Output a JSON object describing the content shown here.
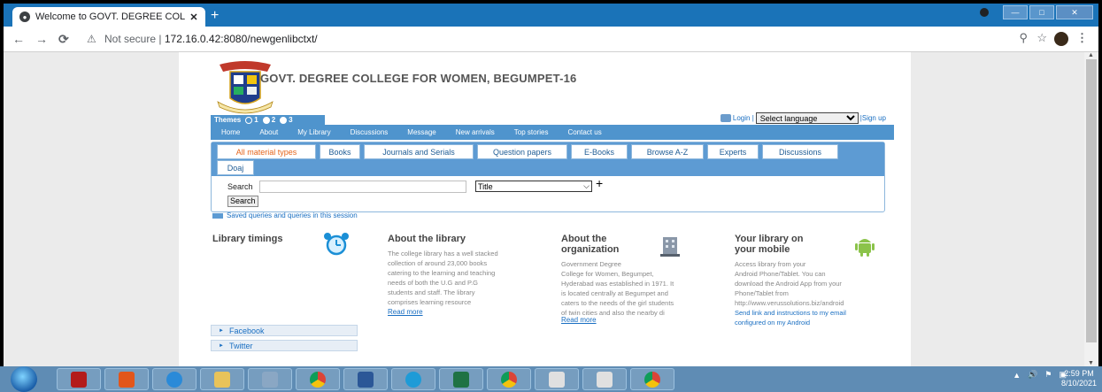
{
  "browser": {
    "tab_title": "Welcome to GOVT. DEGREE COL",
    "new_tab": "+",
    "security_label": "Not secure",
    "separator": "|",
    "url": "172.16.0.42:8080/newgenlibctxt/"
  },
  "site": {
    "college_name": "GOVT. DEGREE COLLEGE FOR WOMEN, BEGUMPET-16",
    "themes_label": "Themes",
    "theme_options": [
      "1",
      "2",
      "3"
    ],
    "login": "Login |",
    "language_select": "Select language",
    "sign_up": "|Sign up",
    "nav": [
      "Home",
      "About",
      "My Library",
      "Discussions",
      "Message",
      "New arrivals",
      "Top stories",
      "Contact us"
    ]
  },
  "search": {
    "tabs": [
      "All material types",
      "Books",
      "Journals and Serials",
      "Question papers",
      "E-Books",
      "Browse A-Z",
      "Experts",
      "Discussions",
      "Doaj"
    ],
    "active_tab": "All material types",
    "label": "Search",
    "field_select": "Title",
    "add": "+",
    "button": "Search",
    "saved_link": "Saved queries and queries in this session"
  },
  "panels": {
    "timings": {
      "title": "Library timings"
    },
    "about": {
      "title": "About the library",
      "text": [
        "The college library has a well stacked",
        "collection of around 23,000 books",
        "catering to the learning and teaching",
        "needs of both the U.G and P.G",
        "students and staff. The library",
        "comprises learning resource"
      ],
      "more": "Read more"
    },
    "org": {
      "title": [
        "About the",
        "organization"
      ],
      "text": [
        "Government Degree",
        "College for Women, Begumpet,",
        "Hyderabad was established in 1971. It",
        "is located centrally at Begumpet and",
        "caters to the needs of the girl students",
        "of twin cities and also the nearby di"
      ],
      "more": "Read more"
    },
    "mobile": {
      "title": [
        "Your library on",
        "your mobile"
      ],
      "text": [
        "Access library from your",
        "Android Phone/Tablet. You can",
        "download the Android App from your",
        "Phone/Tablet from",
        "http://www.verussolutions.biz/android"
      ],
      "link": [
        "Send link and instructions to my email",
        "configured on my Android"
      ]
    }
  },
  "social": [
    "Facebook",
    "Twitter"
  ],
  "taskbar": {
    "time": "2:59 PM",
    "date": "8/10/2021"
  },
  "colors": {
    "nav_blue": "#4f94cd",
    "link_blue": "#1a6fc2",
    "active_tab": "#e5651b"
  }
}
